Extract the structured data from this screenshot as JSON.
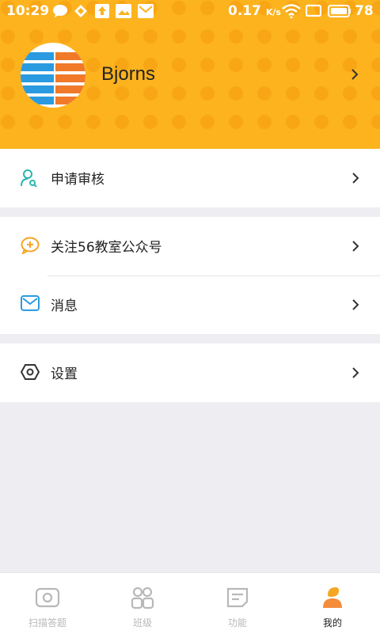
{
  "status_bar": {
    "time": "10:29",
    "network_speed": "0.17",
    "speed_unit": "K/s",
    "battery": "78"
  },
  "profile": {
    "username": "Bjorns",
    "avatar_icon": "class-list-thumbnail"
  },
  "menu": {
    "apply_review": "申请审核",
    "follow_account": "关注56教室公众号",
    "messages": "消息",
    "settings": "设置"
  },
  "tabs": [
    {
      "label": "扫描答题",
      "icon": "scan-icon",
      "active": false
    },
    {
      "label": "班级",
      "icon": "class-icon",
      "active": false
    },
    {
      "label": "功能",
      "icon": "function-icon",
      "active": false
    },
    {
      "label": "我的",
      "icon": "profile-icon",
      "active": true
    }
  ],
  "colors": {
    "header": "#fcb31e",
    "accent_orange": "#f48c3a",
    "teal": "#2bb7b0",
    "blue": "#2a9be0",
    "inactive_gray": "#b8b8b8"
  }
}
